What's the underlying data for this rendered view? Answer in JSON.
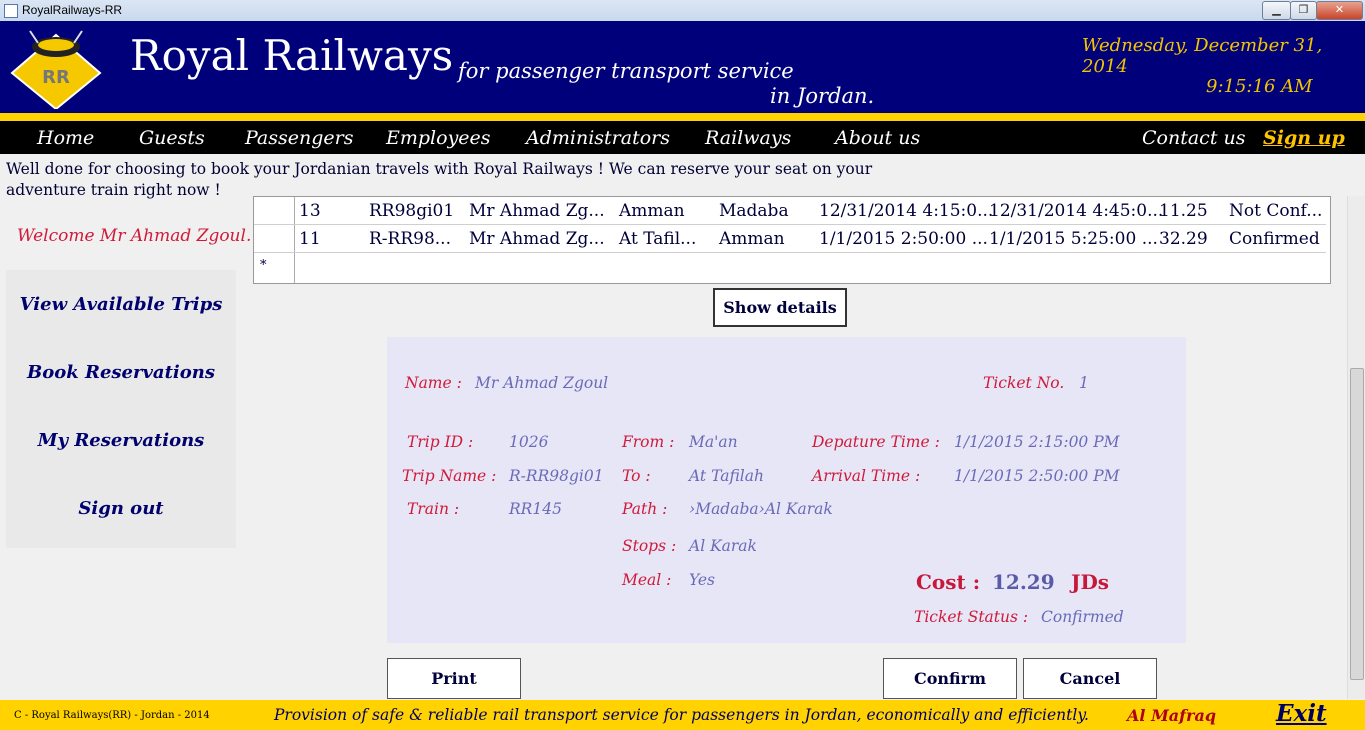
{
  "window": {
    "title": "RoyalRailways-RR",
    "controls": {
      "minimize": "▁",
      "maximize": "❐",
      "close": "✕"
    }
  },
  "header": {
    "logo_text": "RR",
    "brand": "Royal Railways",
    "tagline_line1": "for passenger transport service",
    "tagline_line2": "in Jordan.",
    "date": "Wednesday, December 31, 2014",
    "time": "9:15:16 AM",
    "colors": {
      "header_bg": "#00007a",
      "accent": "#ffd200",
      "date_text": "#f2c400"
    }
  },
  "nav": {
    "items": [
      "Home",
      "Guests",
      "Passengers",
      "Employees",
      "Administrators",
      "Railways",
      "About us"
    ],
    "contact": "Contact us",
    "signup": "Sign up"
  },
  "intro": {
    "text": "Well done for choosing to book your Jordanian travels with Royal Railways !   We can reserve your seat on your adventure train right now !"
  },
  "welcome": "Welcome Mr Ahmad Zgoul.",
  "sidebar": {
    "items": [
      "View Available Trips",
      "Book Reservations",
      "My Reservations",
      "Sign out"
    ]
  },
  "grid": {
    "rows": [
      [
        "13",
        "RR98gi01",
        "Mr Ahmad Zg...",
        "Amman",
        "Madaba",
        "12/31/2014 4:15:0...",
        "12/31/2014 4:45:0...",
        "11.25",
        "Not Conf..."
      ],
      [
        "11",
        "R-RR98...",
        "Mr Ahmad Zg...",
        "At Tafil...",
        "Amman",
        "1/1/2015 2:50:00 ...",
        "1/1/2015 5:25:00 ...",
        "32.29",
        "Confirmed"
      ]
    ],
    "new_row_marker": "*"
  },
  "buttons": {
    "show_details": "Show details",
    "print": "Print",
    "confirm": "Confirm",
    "cancel": "Cancel"
  },
  "details": {
    "name_label": "Name :",
    "name_value": "Mr Ahmad Zgoul",
    "ticket_label": "Ticket No.",
    "ticket_value": "1",
    "trip_id_label": "Trip ID :",
    "trip_id_value": "1026",
    "trip_name_label": "Trip Name :",
    "trip_name_value": "R-RR98gi01",
    "train_label": "Train :",
    "train_value": "RR145",
    "from_label": "From :",
    "from_value": "Ma'an",
    "to_label": "To :",
    "to_value": "At Tafilah",
    "path_label": "Path :",
    "path_value": "›Madaba›Al Karak",
    "stops_label": "Stops :",
    "stops_value": "Al Karak",
    "meal_label": "Meal :",
    "meal_value": "Yes",
    "departure_label": "Depature Time :",
    "departure_value": "1/1/2015 2:15:00 PM",
    "arrival_label": "Arrival Time :",
    "arrival_value": "1/1/2015 2:50:00 PM",
    "cost_label": "Cost :",
    "cost_value": "12.29",
    "cost_unit": "JDs",
    "status_label": "Ticket Status :",
    "status_value": "Confirmed"
  },
  "footer": {
    "copyright": "C - Royal Railways(RR) - Jordan - 2014",
    "motto": "Provision of safe & reliable rail transport service for passengers in Jordan, economically and efficiently.",
    "city": "Al Mafraq",
    "exit": "Exit"
  }
}
